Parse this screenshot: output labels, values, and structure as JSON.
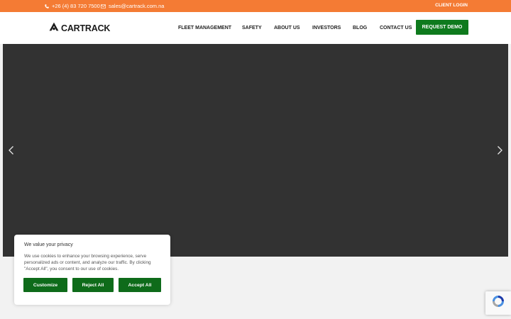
{
  "topbar": {
    "phone": "+26 (4) 83 720 7500",
    "email": "sales@cartrack.com.na",
    "client_login": "CLIENT LOGIN"
  },
  "header": {
    "logo_text": "CARTRACK",
    "nav": [
      {
        "label": "FLEET MANAGEMENT"
      },
      {
        "label": "SAFETY"
      },
      {
        "label": "ABOUT US"
      },
      {
        "label": "INVESTORS"
      },
      {
        "label": "BLOG"
      },
      {
        "label": "CONTACT US"
      }
    ],
    "cta": "REQUEST DEMO"
  },
  "cookie": {
    "title": "We value your privacy",
    "body": "We use cookies to enhance your browsing experience, serve personalized ads or content, and analyze our traffic. By clicking \"Accept All\", you consent to our use of cookies.",
    "buttons": {
      "customize": "Customize",
      "reject": "Reject All",
      "accept": "Accept All"
    }
  },
  "colors": {
    "topbar": "#f47b34",
    "brand_green": "#0e7a1d",
    "hero_bg": "#323232"
  },
  "icons": [
    "phone-icon",
    "mail-icon",
    "cartrack-logo-icon",
    "chevron-left-icon",
    "chevron-right-icon",
    "recaptcha-icon"
  ]
}
